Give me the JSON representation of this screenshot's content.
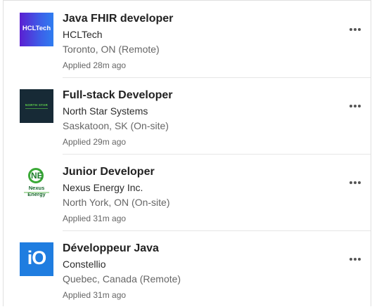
{
  "jobs": [
    {
      "title": "Java FHIR developer",
      "company": "HCLTech",
      "location": "Toronto, ON (Remote)",
      "status": "Applied 28m ago",
      "logo_text": "HCLTech"
    },
    {
      "title": "Full-stack Developer",
      "company": "North Star Systems",
      "location": "Saskatoon, SK (On-site)",
      "status": "Applied 29m ago",
      "logo_text": "NORTH STAR"
    },
    {
      "title": "Junior Developer",
      "company": "Nexus Energy Inc.",
      "location": "North York, ON (On-site)",
      "status": "Applied 31m ago",
      "logo_text": "Nexus Energy"
    },
    {
      "title": "Développeur Java",
      "company": "Constellio",
      "location": "Quebec, Canada (Remote)",
      "status": "Applied 31m ago",
      "logo_text": "iO"
    }
  ],
  "icons": {
    "more": "more-options-icon"
  }
}
